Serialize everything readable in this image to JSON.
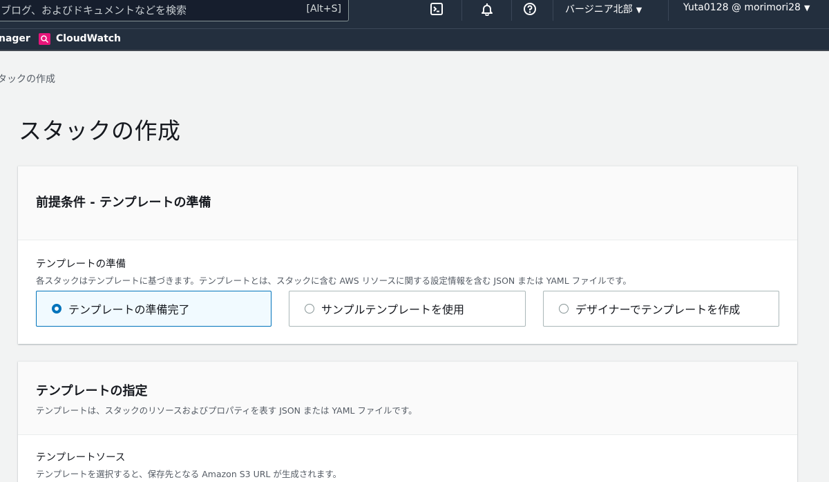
{
  "topnav": {
    "search_placeholder": "ブログ、およびドキュメントなどを検索",
    "search_shortcut": "[Alt+S]",
    "region_label": "バージニア北部",
    "account_label": "Yuta0128 @ morimori28"
  },
  "servicebar": {
    "items": [
      {
        "label": "nager"
      },
      {
        "label": "CloudWatch"
      }
    ]
  },
  "breadcrumb": {
    "current": "タックの作成"
  },
  "page": {
    "title": "スタックの作成"
  },
  "prereq_panel": {
    "title": "前提条件 - テンプレートの準備",
    "field_label": "テンプレートの準備",
    "field_desc": "各スタックはテンプレートに基づきます。テンプレートとは、スタックに含む AWS リソースに関する設定情報を含む JSON または YAML ファイルです。",
    "options": [
      {
        "label": "テンプレートの準備完了",
        "selected": true
      },
      {
        "label": "サンプルテンプレートを使用",
        "selected": false
      },
      {
        "label": "デザイナーでテンプレートを作成",
        "selected": false
      }
    ]
  },
  "template_panel": {
    "title": "テンプレートの指定",
    "desc": "テンプレートは、スタックのリソースおよびプロパティを表す JSON または YAML ファイルです。",
    "source_label": "テンプレートソース",
    "source_desc": "テンプレートを選択すると、保存先となる Amazon S3 URL が生成されます。"
  },
  "colors": {
    "nav_bg": "#232f3e",
    "accent": "#0073bb",
    "cloudwatch": "#e7157b",
    "page_bg": "#f2f3f3"
  },
  "icons": {
    "cloudshell": "terminal-icon",
    "notifications": "bell-icon",
    "help": "help-circle-icon",
    "caret": "caret-down-icon"
  }
}
